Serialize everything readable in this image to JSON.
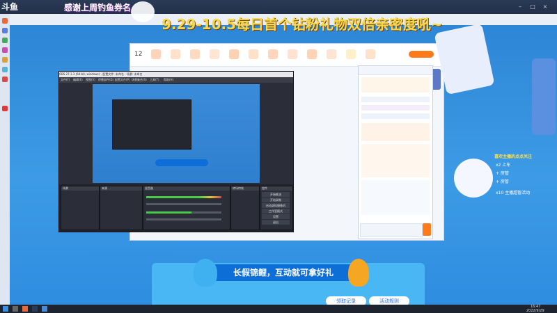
{
  "app": {
    "logo_text": "斗鱼",
    "thanks_text": "感谢上周钓鱼券名"
  },
  "overlay": {
    "headline": "9.29-10.5每日首个钻粉礼物双倍亲密度吼~"
  },
  "obs": {
    "window_title": "OBS 27.1.3 (64-bit, windows) - 配置文件: 未命名 - 场景: 未命名",
    "menu": [
      "文件(F)",
      "编辑(E)",
      "视图(V)",
      "停靠部件(D)",
      "配置文件(P)",
      "场景集合(S)",
      "工具(T)",
      "帮助(H)"
    ],
    "docks": {
      "scenes": "场景",
      "sources": "来源",
      "mixer": "混音器",
      "transitions": "转场特效",
      "controls": "控件"
    },
    "controls": [
      "开始推流",
      "开始录制",
      "启动虚拟摄像机",
      "工作室模式",
      "设置",
      "退出"
    ]
  },
  "stream": {
    "room_number": "12",
    "banner_text": "长假锦鲤，互动就可拿好礼",
    "banner_buttons": [
      "领取记录",
      "活动规则"
    ],
    "follow_label": "喜欢主播的点点关注",
    "rewards": [
      "x2 上车",
      "+ 房管",
      "+ 房管",
      "x10 主播超管活动"
    ]
  },
  "colors": {
    "stream_blue": "#3c9be6",
    "overlay_yellow": "#f6d94a",
    "obs_dark": "#2b2e38",
    "banner_blue": "#0e6ed8",
    "brand_orange": "#ff7a1a"
  },
  "taskbar": {
    "time": "16:47",
    "date": "2022/9/29"
  }
}
